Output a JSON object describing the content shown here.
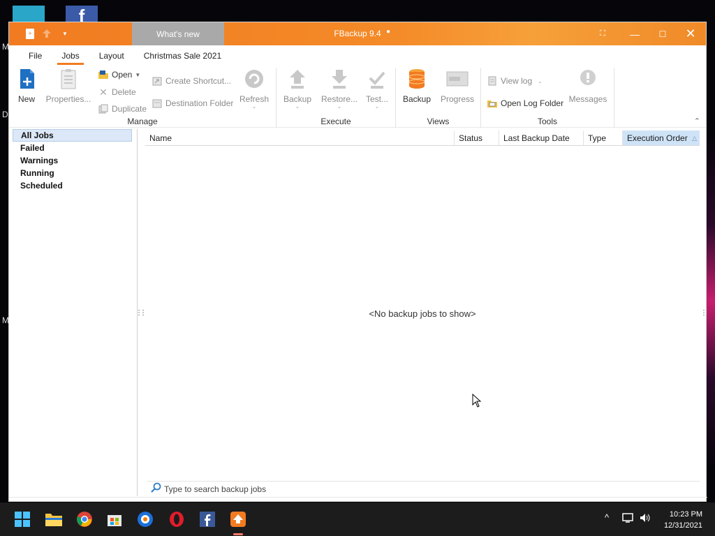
{
  "window": {
    "title": "FBackup 9.4",
    "whats_new": "What's new"
  },
  "tabs": [
    {
      "label": "File"
    },
    {
      "label": "Jobs"
    },
    {
      "label": "Layout"
    },
    {
      "label": "Christmas Sale 2021"
    }
  ],
  "ribbon": {
    "manage": {
      "label": "Manage",
      "new": "New",
      "properties": "Properties...",
      "open": "Open",
      "delete": "Delete",
      "duplicate": "Duplicate",
      "create_shortcut": "Create Shortcut...",
      "destination_folder": "Destination Folder",
      "refresh": "Refresh"
    },
    "execute": {
      "label": "Execute",
      "backup": "Backup",
      "restore": "Restore...",
      "test": "Test..."
    },
    "views": {
      "label": "Views",
      "backup": "Backup",
      "progress": "Progress"
    },
    "tools": {
      "label": "Tools",
      "view_log": "View log",
      "open_log_folder": "Open Log Folder",
      "messages": "Messages"
    }
  },
  "filters": [
    {
      "label": "All Jobs",
      "selected": true
    },
    {
      "label": "Failed"
    },
    {
      "label": "Warnings"
    },
    {
      "label": "Running"
    },
    {
      "label": "Scheduled"
    }
  ],
  "columns": [
    {
      "label": "Name"
    },
    {
      "label": "Status"
    },
    {
      "label": "Last Backup Date"
    },
    {
      "label": "Type"
    },
    {
      "label": "Execution Order",
      "sorted": "ascending"
    }
  ],
  "empty_message": "<No backup jobs to show>",
  "search": {
    "placeholder": "Type to search backup jobs"
  },
  "taskbar": {
    "apps": [
      "windows-start",
      "file-explorer",
      "chrome",
      "microsoft-store",
      "browser",
      "opera",
      "facebook",
      "fbackup"
    ],
    "time": "10:23 PM",
    "date": "12/31/2021"
  },
  "colors": {
    "accent": "#f27b21",
    "selection": "#dce8f7"
  }
}
